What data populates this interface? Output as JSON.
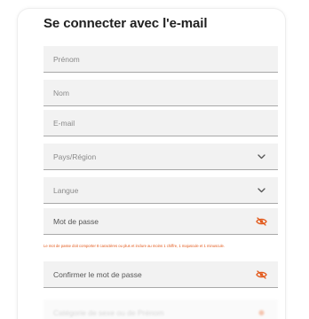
{
  "form": {
    "title": "Se connecter avec l'e-mail",
    "fields": {
      "prenom": "Prénom",
      "nom": "Nom",
      "email": "E-mail",
      "pays": "Pays/Région",
      "langue": "Langue",
      "mdp": "Mot de passe",
      "confirm": "Confirmer le mot de passe",
      "hidden": "Catégorie de sexe ou de Prénom"
    },
    "password_hint": "Le mot de passe doit comporter 8 caractères ou plus et inclure au moins 1 chiffre, 1 majuscule et 1 minuscule."
  },
  "colors": {
    "accent": "#e35a1c",
    "field_bg": "#f2f2f2",
    "field_border": "#a8a8a8"
  },
  "icons": {
    "select": "chevron-down-icon",
    "password": "eye-off-icon"
  }
}
